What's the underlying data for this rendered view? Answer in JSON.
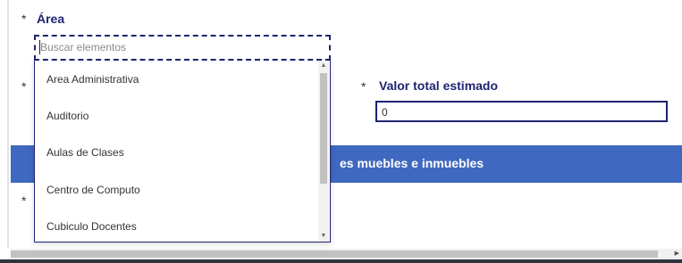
{
  "form": {
    "area": {
      "required_mark": "*",
      "label": "Área"
    },
    "row2_required_mark": "*",
    "valor": {
      "required_mark": "*",
      "label": "Valor total estimado",
      "value": "0"
    },
    "row3_required_mark": "*"
  },
  "section_banner": {
    "text": "es muebles e inmuebles",
    "color": "#3f68c0"
  },
  "dropdown": {
    "search_placeholder": "Buscar elementos",
    "search_value": "",
    "options": [
      "Area Administrativa",
      "Auditorio",
      "Aulas de Clases",
      "Centro de Computo",
      "Cubiculo Docentes"
    ]
  },
  "icons": {
    "scroll_up": "▲",
    "scroll_down": "▼",
    "scroll_right": "▶"
  },
  "colors": {
    "label_navy": "#1f2470",
    "accent_blue": "#3f68c0"
  }
}
